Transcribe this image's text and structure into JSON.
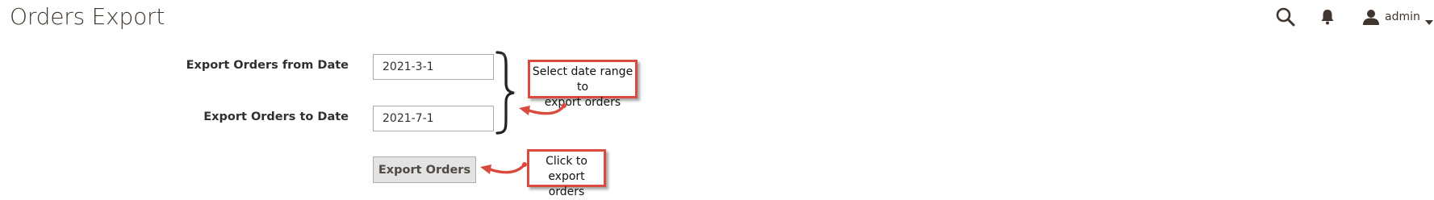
{
  "page": {
    "title": "Orders Export"
  },
  "header": {
    "search_icon": "search-icon",
    "notifications_icon": "bell-icon",
    "user_icon": "user-icon",
    "username": "admin",
    "dropdown_icon": "caret-down-icon"
  },
  "form": {
    "from_date": {
      "label": "Export Orders from Date",
      "value": "2021-3-1"
    },
    "to_date": {
      "label": "Export Orders to Date",
      "value": "2021-7-1"
    },
    "export_button": "Export Orders"
  },
  "annotations": {
    "date_callout": {
      "line1": "Select date range to",
      "line2": "export orders"
    },
    "export_callout": {
      "line1": "Click to",
      "line2": "export orders"
    },
    "callout_border_color": "#d94a3f",
    "arrow_color": "#d94a3f"
  }
}
